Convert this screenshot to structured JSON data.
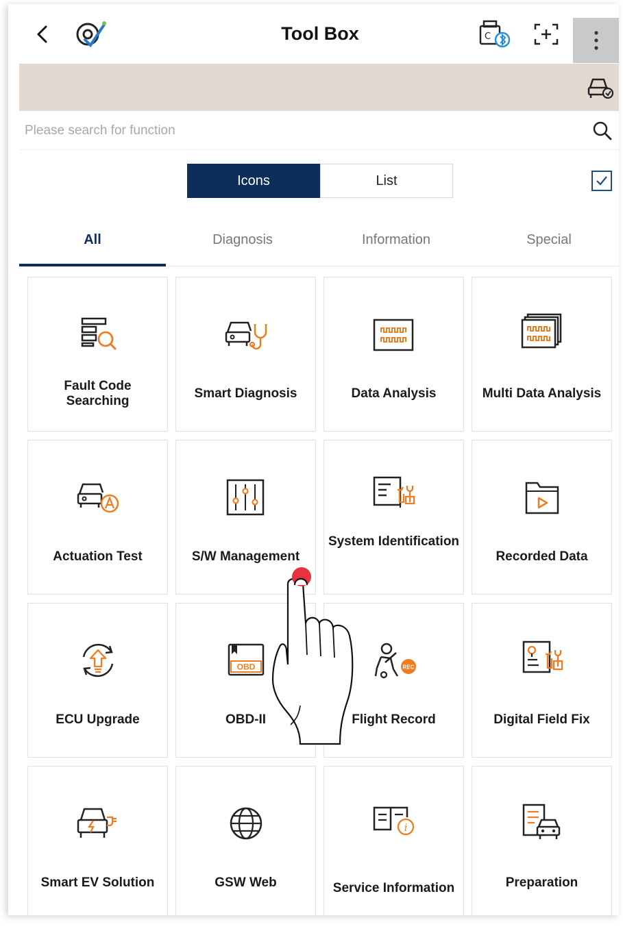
{
  "header": {
    "title": "Tool Box",
    "back_icon": "back-arrow-icon",
    "logo_icon": "gdsm-logo-icon",
    "vci_icon": "vci-bluetooth-icon",
    "capture_icon": "screen-capture-icon",
    "more_icon": "more-vertical-icon"
  },
  "vehicle_bar": {
    "icon": "vehicle-select-icon",
    "color": "#e3d9d0"
  },
  "search": {
    "placeholder": "Please search for function",
    "icon": "search-icon"
  },
  "view_toggle": {
    "options": [
      "Icons",
      "List"
    ],
    "selected": "Icons",
    "checkbox_checked": true
  },
  "tabs": {
    "items": [
      "All",
      "Diagnosis",
      "Information",
      "Special"
    ],
    "active": "All"
  },
  "tools": [
    {
      "label": "Fault Code Searching",
      "icon": "fault-code-search-icon"
    },
    {
      "label": "Smart Diagnosis",
      "icon": "smart-diagnosis-icon"
    },
    {
      "label": "Data Analysis",
      "icon": "data-analysis-icon"
    },
    {
      "label": "Multi Data Analysis",
      "icon": "multi-data-analysis-icon"
    },
    {
      "label": "Actuation Test",
      "icon": "actuation-test-icon"
    },
    {
      "label": "S/W Management",
      "icon": "sw-management-icon"
    },
    {
      "label": "System Identification",
      "icon": "system-identification-icon"
    },
    {
      "label": "Recorded Data",
      "icon": "recorded-data-icon"
    },
    {
      "label": "ECU Upgrade",
      "icon": "ecu-upgrade-icon"
    },
    {
      "label": "OBD-II",
      "icon": "obd-ii-icon"
    },
    {
      "label": "Flight Record",
      "icon": "flight-record-icon"
    },
    {
      "label": "Digital Field Fix",
      "icon": "digital-field-fix-icon"
    },
    {
      "label": "Smart EV Solution",
      "icon": "smart-ev-solution-icon"
    },
    {
      "label": "GSW Web",
      "icon": "gsw-web-icon"
    },
    {
      "label": "Service Information",
      "icon": "service-information-icon"
    },
    {
      "label": "Preparation",
      "icon": "preparation-icon"
    }
  ],
  "obd_badge": "OBD",
  "rec_badge": "REC",
  "colors": {
    "accent": "#0d2e5a",
    "icon_orange": "#f07c22",
    "icon_dark": "#222222",
    "touch_dot": "#e8323c"
  }
}
